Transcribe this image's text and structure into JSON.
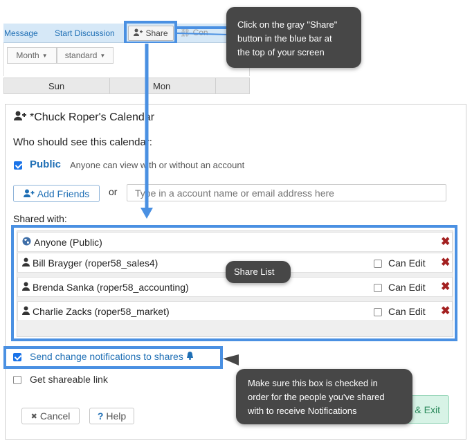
{
  "toolbar": {
    "message": "Message",
    "start_discussion": "Start Discussion",
    "share": "Share",
    "cut_item": "Con",
    "view_dropdown": "Month",
    "style_dropdown": "standard"
  },
  "calendar": {
    "days": [
      "Sun",
      "Mon"
    ]
  },
  "dialog": {
    "title": "*Chuck Roper's Calendar",
    "who_label": "Who should see this calendar:",
    "public_label": "Public",
    "public_desc": "Anyone can view with or without an account",
    "add_friends": "Add Friends",
    "or": "or",
    "search_placeholder": "Type in a account name or email address here",
    "shared_with_label": "Shared with:",
    "share_rows": [
      {
        "name": "Anyone (Public)",
        "can_edit": "",
        "icon": "globe-icon"
      },
      {
        "name": "Bill Brayger (roper58_sales4)",
        "can_edit": "Can Edit",
        "icon": "user-icon"
      },
      {
        "name": "Brenda Sanka (roper58_accounting)",
        "can_edit": "Can Edit",
        "icon": "user-icon"
      },
      {
        "name": "Charlie Zacks (roper58_market)",
        "can_edit": "Can Edit",
        "icon": "user-icon"
      }
    ],
    "notify_label": "Send change notifications to shares",
    "link_label": "Get shareable link",
    "cancel": "Cancel",
    "help": "Help",
    "save_exit": "& Exit"
  },
  "tooltips": {
    "share_tip": [
      "Click on the gray \"Share\"",
      "button in the blue bar at",
      "the top of your screen"
    ],
    "list_tip": "Share List",
    "notify_tip": [
      "Make sure this box is checked in",
      "order for the people you've shared",
      "with to receive Notifications"
    ]
  },
  "colors": {
    "highlight": "#4a90e2",
    "link_blue": "#1f6fb5",
    "tooltip_bg": "#474747",
    "remove_red": "#a32020",
    "save_green": "#d7f3e6"
  }
}
